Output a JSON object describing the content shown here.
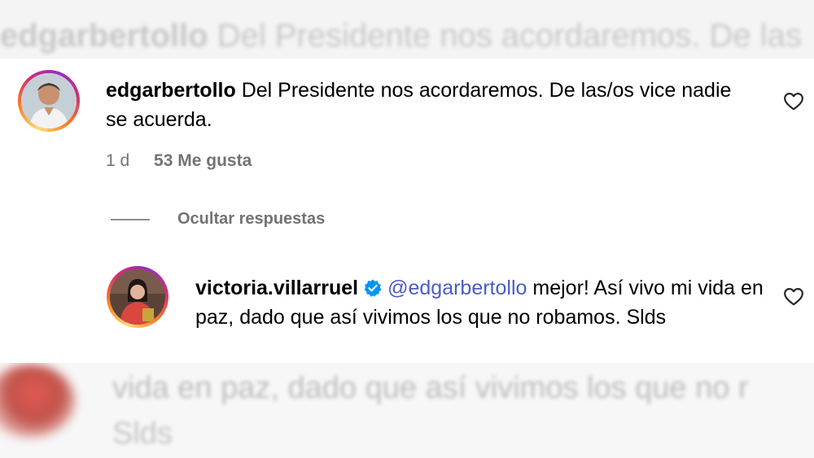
{
  "blurred_background": {
    "top_text_user": "edgarbertollo",
    "top_text": "Del Presidente nos acordaremos. De las",
    "bottom_line1": "vida en paz, dado que así vivimos los que no r",
    "bottom_line2": "Slds"
  },
  "comment": {
    "username": "edgarbertollo",
    "text": "Del Presidente nos acordaremos. De las/os vice nadie se acuerda.",
    "time": "1 d",
    "likes": "53 Me gusta",
    "like_icon": "heart-icon"
  },
  "replies_toggle": {
    "label": "Ocultar respuestas"
  },
  "reply": {
    "username": "victoria.villarruel",
    "verified": true,
    "mention": "@edgarbertollo",
    "text": "mejor! Así vivo mi vida en paz, dado que así vivimos los que no robamos. Slds",
    "like_icon": "heart-icon"
  },
  "colors": {
    "mention": "#4b5cc4",
    "verified_badge": "#0095f6",
    "meta_text": "#737373"
  }
}
